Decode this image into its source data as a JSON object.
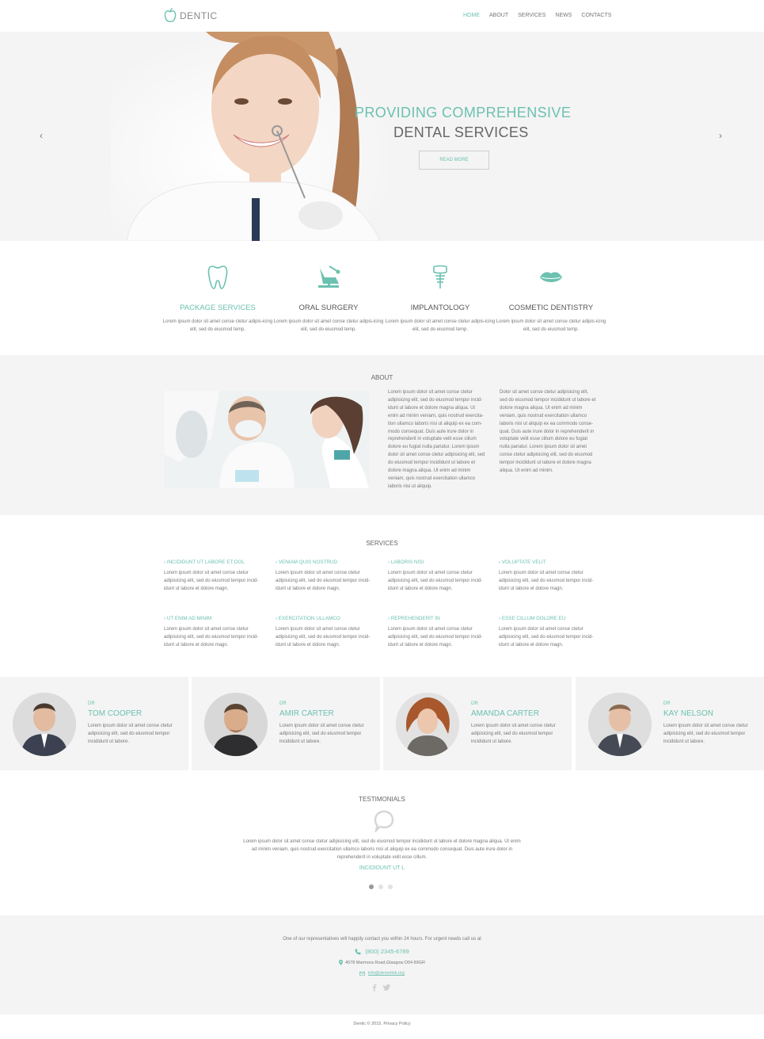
{
  "header": {
    "logo_text": "DENTIC",
    "nav": [
      "HOME",
      "ABOUT",
      "SERVICES",
      "NEWS",
      "CONTACTS"
    ],
    "active_nav": "HOME"
  },
  "hero": {
    "title_line1": "PROVIDING COMPREHENSIVE",
    "title_line2": "DENTAL SERVICES",
    "button_label": "READ MORE",
    "prev_arrow": "‹",
    "next_arrow": "›"
  },
  "features": [
    {
      "icon": "tooth-icon",
      "title": "PACKAGE SERVICES",
      "text": "Lorem ipsum dolor sit amet conse ctetur adipis-icing elit, sed do eiusmod temp."
    },
    {
      "icon": "dental-chair-icon",
      "title": "ORAL SURGERY",
      "text": "Lorem ipsum dolor sit amet conse ctetur adipis-icing elit, sed do eiusmod temp."
    },
    {
      "icon": "dental-implant-icon",
      "title": "IMPLANTOLOGY",
      "text": "Lorem ipsum dolor sit amet conse ctetur adipis-icing elit, sed do eiusmod temp."
    },
    {
      "icon": "lips-icon",
      "title": "COSMETIC DENTISTRY",
      "text": "Lorem ipsum dolor sit amet conse ctetur adipis-icing elit, sed do eiusmod temp."
    }
  ],
  "about": {
    "title": "ABOUT",
    "col1": "Lorem ipsum dolor sit amet conse ctetur adipisicing elit, sed do eiusmod tempor incid-idunt ut labore et dolore magna aliqua. Ut enim ad minim veniam, quis nostrud exercita-tion ullamco laboris nisi ut aliquip ex ea com-modo consequat. Duis aute irure dolor in reprehenderit in voluptate velit esse cillum dolore eu fugiat nulla pariatur. Lorem ipsum dolor sit amet conse ctetur adipisicing elit, sed do eiusmod tempor incididunt ut labore et dolore magna aliqua. Ut enim ad minim veniam, quis nostrud exercitation ullamco laboris nisi ut aliquip.",
    "col2": "Dolor sit amet conse ctetur adipisicing elit, sed do eiusmod tempor incididunt ut labore et dolore magna aliqua. Ut enim ad minim veniam, quis nostrud exercitation ullamco laboris nisi ut aliquip ex ea commodo conse-quat. Duis aute irure dolor in reprehenderit in voluptate velit esse cillum dolore eu fugiat nulla pariatur. Lorem ipsum dolor sit amet conse ctetur adipisicing elit, sed do eiusmod tempor incididunt ut labore et dolore magna aliqua. Ut enim ad minim."
  },
  "services": {
    "title": "SERVICES",
    "items": [
      {
        "title": "INCIDIDUNT UT LABORE ET DOL",
        "text": "Lorem ipsum dolor sit amet conse ctetur adipisicing elit, sed do eiusmod tempor incid-idunt ut labore et dolore magn."
      },
      {
        "title": "VENIAM QUIS NOSTRUD",
        "text": "Lorem ipsum dolor sit amet conse ctetur adipisicing elit, sed do eiusmod tempor incid-idunt ut labore et dolore magn."
      },
      {
        "title": "LABORIS NISI",
        "text": "Lorem ipsum dolor sit amet conse ctetur adipisicing elit, sed do eiusmod tempor incid-idunt ut labore et dolore magn."
      },
      {
        "title": "VOLUPTATE VELIT",
        "text": "Lorem ipsum dolor sit amet conse ctetur adipisicing elit, sed do eiusmod tempor incid-idunt ut labore et dolore magn."
      },
      {
        "title": "UT ENIM AD MINIM",
        "text": "Lorem ipsum dolor sit amet conse ctetur adipisicing elit, sed do eiusmod tempor incid-idunt ut labore et dolore magn."
      },
      {
        "title": "EXERCITATION ULLAMCO",
        "text": "Lorem ipsum dolor sit amet conse ctetur adipisicing elit, sed do eiusmod tempor incid-idunt ut labore et dolore magn."
      },
      {
        "title": "REPREHENDERIT IN",
        "text": "Lorem ipsum dolor sit amet conse ctetur adipisicing elit, sed do eiusmod tempor incid-idunt ut labore et dolore magn."
      },
      {
        "title": "ESSE CILLUM DOLORE EU",
        "text": "Lorem ipsum dolor sit amet conse ctetur adipisicing elit, sed do eiusmod tempor incid-idunt ut labore et dolore magn."
      }
    ]
  },
  "team": [
    {
      "role": "DR",
      "name": "TOM COOPER",
      "text": "Lorem ipsum dolor sit amet conse ctetur adipisicing elit, sed do eiusmod tempor incididunt ut labore."
    },
    {
      "role": "DR",
      "name": "AMIR CARTER",
      "text": "Lorem ipsum dolor sit amet conse ctetur adipisicing elit, sed do eiusmod tempor incididunt ut labore."
    },
    {
      "role": "DR",
      "name": "AMANDA CARTER",
      "text": "Lorem ipsum dolor sit amet conse ctetur adipisicing elit, sed do eiusmod tempor incididunt ut labore."
    },
    {
      "role": "DR",
      "name": "KAY NELSON",
      "text": "Lorem ipsum dolor sit amet conse ctetur adipisicing elit, sed do eiusmod tempor incididunt ut labore."
    }
  ],
  "testimonials": {
    "title": "TESTIMONIALS",
    "text": "Lorem ipsum dolor sit amet conse ctetur adipisicing elit, sed do eiusmod tempor incididunt ut labore et dolore magna aliqua. Ut enim ad minim veniam, quis nostrud exercitation ullamco laboris nisi ut aliquip ex ea commodo consequat. Duis aute irure dolor in reprehenderit in voluptate velit esse cillum.",
    "author": "INCIDIDUNT UT L",
    "dots": 3,
    "active_dot": 0
  },
  "contact": {
    "intro": "One of our representatives will happily contact you within 24 hours. For urgent needs call us at",
    "phone": "(800) 2345-6789",
    "address": "4578 Marmora Road,Glasgow D04 89GR",
    "email": "info@demolink.org"
  },
  "footer": {
    "text": "Dentic © 2015. Privacy Policy"
  },
  "colors": {
    "accent": "#6cc1b0",
    "panel": "#f4f4f4"
  }
}
